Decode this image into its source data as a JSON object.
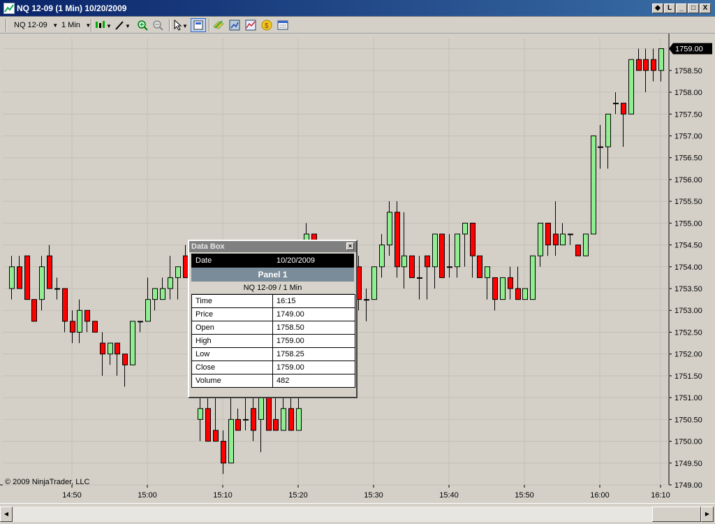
{
  "window": {
    "title": "NQ 12-09 (1 Min)  10/20/2009",
    "buttons": [
      "◆",
      "L",
      "_",
      "□",
      "X"
    ]
  },
  "toolbar": {
    "instrument": "NQ 12-09",
    "interval": "1 Min",
    "icons": [
      "bar-style-icon",
      "drawing-tool-icon",
      "zoom-in-icon",
      "zoom-out-icon",
      "pointer-icon",
      "data-box-icon",
      "instruments-icon",
      "properties-icon",
      "indicators-icon",
      "strategies-icon",
      "chart-trader-icon"
    ]
  },
  "colors": {
    "up_candle": "#90ee90",
    "down_candle": "#ff0000",
    "background": "#d4d0c8",
    "last_price_tag": "#000000"
  },
  "chart_data": {
    "type": "candlestick",
    "x_tick_labels": [
      "14:50",
      "15:00",
      "15:10",
      "15:20",
      "15:30",
      "15:40",
      "15:50",
      "16:00",
      "16:10"
    ],
    "y_tick_labels": [
      "1759.00",
      "1758.50",
      "1758.00",
      "1757.50",
      "1757.00",
      "1756.50",
      "1756.00",
      "1755.50",
      "1755.00",
      "1754.50",
      "1754.00",
      "1753.50",
      "1753.00",
      "1752.50",
      "1752.00",
      "1751.50",
      "1751.00",
      "1750.50",
      "1750.00",
      "1749.50",
      "1749.00"
    ],
    "ylim": [
      1749.0,
      1759.25
    ],
    "last_price": "1759.00",
    "grid": true,
    "candles": [
      {
        "o": 1753.5,
        "h": 1754.25,
        "l": 1753.25,
        "c": 1754.0
      },
      {
        "o": 1754.0,
        "h": 1754.25,
        "l": 1753.5,
        "c": 1753.5
      },
      {
        "o": 1754.25,
        "h": 1754.25,
        "l": 1753.25,
        "c": 1753.25
      },
      {
        "o": 1753.25,
        "h": 1753.25,
        "l": 1752.75,
        "c": 1752.75
      },
      {
        "o": 1753.25,
        "h": 1754.25,
        "l": 1753.0,
        "c": 1754.0
      },
      {
        "o": 1754.25,
        "h": 1754.5,
        "l": 1753.5,
        "c": 1753.5
      },
      {
        "o": 1753.5,
        "h": 1753.75,
        "l": 1753.25,
        "c": 1753.5
      },
      {
        "o": 1753.5,
        "h": 1753.5,
        "l": 1752.5,
        "c": 1752.75
      },
      {
        "o": 1752.75,
        "h": 1753.0,
        "l": 1752.25,
        "c": 1752.5
      },
      {
        "o": 1752.5,
        "h": 1753.25,
        "l": 1752.25,
        "c": 1753.0
      },
      {
        "o": 1753.0,
        "h": 1753.0,
        "l": 1752.5,
        "c": 1752.75
      },
      {
        "o": 1752.75,
        "h": 1752.75,
        "l": 1752.5,
        "c": 1752.5
      },
      {
        "o": 1752.25,
        "h": 1752.5,
        "l": 1751.5,
        "c": 1752.0
      },
      {
        "o": 1752.0,
        "h": 1752.25,
        "l": 1751.75,
        "c": 1752.25
      },
      {
        "o": 1752.25,
        "h": 1752.25,
        "l": 1751.5,
        "c": 1752.0
      },
      {
        "o": 1752.0,
        "h": 1752.0,
        "l": 1751.25,
        "c": 1751.75
      },
      {
        "o": 1751.75,
        "h": 1752.75,
        "l": 1751.75,
        "c": 1752.75
      },
      {
        "o": 1752.75,
        "h": 1752.75,
        "l": 1752.5,
        "c": 1752.75
      },
      {
        "o": 1752.75,
        "h": 1753.75,
        "l": 1752.75,
        "c": 1753.25
      },
      {
        "o": 1753.25,
        "h": 1753.5,
        "l": 1753.0,
        "c": 1753.5
      },
      {
        "o": 1753.25,
        "h": 1753.75,
        "l": 1753.25,
        "c": 1753.5
      },
      {
        "o": 1753.5,
        "h": 1754.25,
        "l": 1753.25,
        "c": 1753.75
      },
      {
        "o": 1753.75,
        "h": 1754.0,
        "l": 1753.25,
        "c": 1754.0
      },
      {
        "o": 1754.25,
        "h": 1754.5,
        "l": 1753.75,
        "c": 1753.75
      },
      {
        "o": 1753.75,
        "h": 1754.0,
        "l": 1753.5,
        "c": 1753.5
      },
      {
        "o": 1750.5,
        "h": 1751.0,
        "l": 1750.0,
        "c": 1750.75
      },
      {
        "o": 1750.75,
        "h": 1751.0,
        "l": 1750.0,
        "c": 1750.0
      },
      {
        "o": 1750.25,
        "h": 1751.0,
        "l": 1750.0,
        "c": 1750.0
      },
      {
        "o": 1750.0,
        "h": 1750.25,
        "l": 1749.25,
        "c": 1749.5
      },
      {
        "o": 1749.5,
        "h": 1751.0,
        "l": 1749.5,
        "c": 1750.5
      },
      {
        "o": 1750.5,
        "h": 1750.75,
        "l": 1750.25,
        "c": 1750.25
      },
      {
        "o": 1750.5,
        "h": 1751.0,
        "l": 1750.25,
        "c": 1750.5
      },
      {
        "o": 1750.75,
        "h": 1751.0,
        "l": 1750.0,
        "c": 1750.25
      },
      {
        "o": 1750.5,
        "h": 1751.0,
        "l": 1749.75,
        "c": 1751.0
      },
      {
        "o": 1751.0,
        "h": 1751.0,
        "l": 1750.25,
        "c": 1750.25
      },
      {
        "o": 1750.5,
        "h": 1751.0,
        "l": 1750.25,
        "c": 1750.25
      },
      {
        "o": 1750.25,
        "h": 1751.0,
        "l": 1750.25,
        "c": 1750.75
      },
      {
        "o": 1750.75,
        "h": 1751.0,
        "l": 1750.25,
        "c": 1750.25
      },
      {
        "o": 1750.25,
        "h": 1751.0,
        "l": 1750.25,
        "c": 1750.75
      },
      {
        "o": 1753.0,
        "h": 1755.0,
        "l": 1753.0,
        "c": 1754.75
      },
      {
        "o": 1754.75,
        "h": 1754.75,
        "l": 1754.0,
        "c": 1754.0
      },
      {
        "o": 1753.75,
        "h": 1754.0,
        "l": 1752.75,
        "c": 1753.5
      },
      {
        "o": 1753.5,
        "h": 1753.75,
        "l": 1753.25,
        "c": 1753.75
      },
      {
        "o": 1754.0,
        "h": 1754.0,
        "l": 1753.0,
        "c": 1753.25
      },
      {
        "o": 1753.25,
        "h": 1753.75,
        "l": 1753.0,
        "c": 1753.25
      },
      {
        "o": 1753.5,
        "h": 1754.25,
        "l": 1753.25,
        "c": 1754.0
      },
      {
        "o": 1754.0,
        "h": 1754.25,
        "l": 1753.0,
        "c": 1753.25
      },
      {
        "o": 1753.25,
        "h": 1753.5,
        "l": 1752.75,
        "c": 1753.25
      },
      {
        "o": 1753.25,
        "h": 1754.0,
        "l": 1753.25,
        "c": 1754.0
      },
      {
        "o": 1754.0,
        "h": 1754.75,
        "l": 1753.75,
        "c": 1754.5
      },
      {
        "o": 1754.5,
        "h": 1755.5,
        "l": 1754.25,
        "c": 1755.25
      },
      {
        "o": 1755.25,
        "h": 1755.5,
        "l": 1753.75,
        "c": 1754.0
      },
      {
        "o": 1754.0,
        "h": 1755.25,
        "l": 1753.5,
        "c": 1754.25
      },
      {
        "o": 1754.25,
        "h": 1754.25,
        "l": 1753.75,
        "c": 1753.75
      },
      {
        "o": 1753.75,
        "h": 1754.25,
        "l": 1753.25,
        "c": 1753.75
      },
      {
        "o": 1754.25,
        "h": 1754.25,
        "l": 1753.25,
        "c": 1754.0
      },
      {
        "o": 1754.0,
        "h": 1754.5,
        "l": 1753.5,
        "c": 1754.75
      },
      {
        "o": 1754.75,
        "h": 1754.75,
        "l": 1753.75,
        "c": 1753.75
      },
      {
        "o": 1754.0,
        "h": 1754.75,
        "l": 1753.75,
        "c": 1754.0
      },
      {
        "o": 1754.0,
        "h": 1754.75,
        "l": 1753.75,
        "c": 1754.75
      },
      {
        "o": 1754.75,
        "h": 1755.0,
        "l": 1754.0,
        "c": 1755.0
      },
      {
        "o": 1755.0,
        "h": 1755.0,
        "l": 1753.75,
        "c": 1754.25
      },
      {
        "o": 1754.25,
        "h": 1754.25,
        "l": 1753.75,
        "c": 1753.75
      },
      {
        "o": 1753.75,
        "h": 1754.0,
        "l": 1753.25,
        "c": 1754.0
      },
      {
        "o": 1753.75,
        "h": 1753.75,
        "l": 1753.0,
        "c": 1753.25
      },
      {
        "o": 1753.25,
        "h": 1753.75,
        "l": 1753.25,
        "c": 1753.75
      },
      {
        "o": 1753.75,
        "h": 1754.0,
        "l": 1753.25,
        "c": 1753.5
      },
      {
        "o": 1753.5,
        "h": 1754.0,
        "l": 1753.25,
        "c": 1753.25
      },
      {
        "o": 1753.25,
        "h": 1753.5,
        "l": 1753.25,
        "c": 1753.5
      },
      {
        "o": 1753.25,
        "h": 1754.25,
        "l": 1753.25,
        "c": 1754.25
      },
      {
        "o": 1754.25,
        "h": 1755.0,
        "l": 1754.0,
        "c": 1755.0
      },
      {
        "o": 1755.0,
        "h": 1755.0,
        "l": 1754.25,
        "c": 1754.5
      },
      {
        "o": 1754.75,
        "h": 1755.5,
        "l": 1754.25,
        "c": 1754.5
      },
      {
        "o": 1754.5,
        "h": 1755.0,
        "l": 1754.5,
        "c": 1754.75
      },
      {
        "o": 1754.75,
        "h": 1754.75,
        "l": 1754.5,
        "c": 1754.75
      },
      {
        "o": 1754.5,
        "h": 1754.5,
        "l": 1754.25,
        "c": 1754.25
      },
      {
        "o": 1754.25,
        "h": 1754.75,
        "l": 1754.25,
        "c": 1754.75
      },
      {
        "o": 1754.75,
        "h": 1757.0,
        "l": 1754.75,
        "c": 1757.0
      },
      {
        "o": 1756.75,
        "h": 1757.25,
        "l": 1756.25,
        "c": 1756.75
      },
      {
        "o": 1756.75,
        "h": 1757.5,
        "l": 1756.25,
        "c": 1757.5
      },
      {
        "o": 1757.75,
        "h": 1758.0,
        "l": 1757.5,
        "c": 1757.75
      },
      {
        "o": 1757.75,
        "h": 1757.75,
        "l": 1756.75,
        "c": 1757.5
      },
      {
        "o": 1757.5,
        "h": 1758.75,
        "l": 1757.5,
        "c": 1758.75
      },
      {
        "o": 1758.75,
        "h": 1759.0,
        "l": 1758.5,
        "c": 1758.5
      },
      {
        "o": 1758.75,
        "h": 1759.0,
        "l": 1758.0,
        "c": 1758.5
      },
      {
        "o": 1758.75,
        "h": 1759.0,
        "l": 1758.25,
        "c": 1758.5
      },
      {
        "o": 1758.5,
        "h": 1759.0,
        "l": 1758.25,
        "c": 1759.0
      }
    ]
  },
  "copyright": "© 2009 NinjaTrader, LLC",
  "databox": {
    "title": "Data Box",
    "date_label": "Date",
    "date_value": "10/20/2009",
    "panel": "Panel 1",
    "instrument": "NQ 12-09 / 1 Min",
    "rows": [
      {
        "k": "Time",
        "v": "16:15"
      },
      {
        "k": "Price",
        "v": "1749.00"
      },
      {
        "k": "Open",
        "v": "1758.50"
      },
      {
        "k": "High",
        "v": "1759.00"
      },
      {
        "k": "Low",
        "v": "1758.25"
      },
      {
        "k": "Close",
        "v": "1759.00"
      },
      {
        "k": "Volume",
        "v": "482"
      }
    ]
  }
}
